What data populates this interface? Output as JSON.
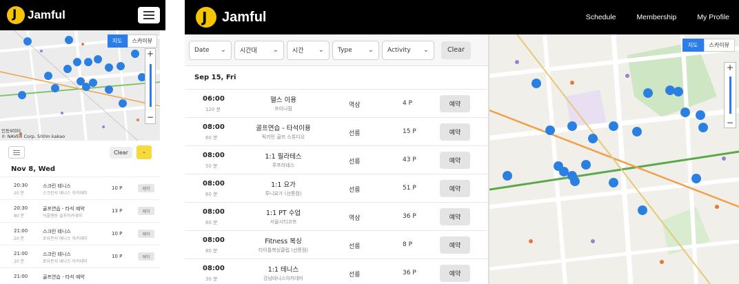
{
  "brand": {
    "name": "Jamful",
    "logo_letter": "J",
    "color": "#f6c400"
  },
  "mobile": {
    "map": {
      "type_buttons": [
        "지도",
        "스카이뷰"
      ],
      "footer_line1": "인동9미터",
      "footer_line2": "© NAVER Corp. 500m kakao"
    },
    "filters": {
      "clear": "Clear",
      "toggle_icon": "list-icon",
      "yellow": "-"
    },
    "date": "Nov 8, Wed",
    "sessions": [
      {
        "time": "20:30",
        "dur": "20 분",
        "title": "스크린 테니스",
        "sub": "스크린서 테니스 아카데미",
        "points": "10 P",
        "action": "예약"
      },
      {
        "time": "20:30",
        "dur": "80 분",
        "title": "골프연습 - 타석 예약",
        "sub": "어플렌동 골프아카데미",
        "points": "13 P",
        "action": "예약"
      },
      {
        "time": "21:00",
        "dur": "20 분",
        "title": "스크린 테니스",
        "sub": "로사몬서 테니스 아카데미",
        "points": "10 P",
        "action": "예약"
      },
      {
        "time": "21:00",
        "dur": "20 분",
        "title": "스크린 테니스",
        "sub": "로사몬서 테니스 아카데미",
        "points": "10 P",
        "action": "예약"
      },
      {
        "time": "21:00",
        "dur": "",
        "title": "골프연습 - 타석 예약",
        "sub": "",
        "points": "",
        "action": ""
      }
    ]
  },
  "desktop": {
    "nav": [
      "Schedule",
      "Membership",
      "My Profile"
    ],
    "filters": [
      "Date",
      "시간대",
      "시간",
      "Type",
      "Activity"
    ],
    "clear": "Clear",
    "date": "Sep 15, Fri",
    "sessions": [
      {
        "time": "06:00",
        "dur": "120 분",
        "title": "헬스 이용",
        "sub": "프이나짐",
        "loc": "역삼",
        "points": "4 P",
        "action": "예약"
      },
      {
        "time": "08:00",
        "dur": "60 분",
        "title": "골프연습 - 타석이용",
        "sub": "픽키민 골프 스튜디오",
        "loc": "선릉",
        "points": "15 P",
        "action": "예약"
      },
      {
        "time": "08:00",
        "dur": "50 분",
        "title": "1:1 필라테스",
        "sub": "루프라테스",
        "loc": "선릉",
        "points": "43 P",
        "action": "예약"
      },
      {
        "time": "08:00",
        "dur": "60 분",
        "title": "1:1 요가",
        "sub": "루니요가 (선릉점)",
        "loc": "선릉",
        "points": "51 P",
        "action": "예약"
      },
      {
        "time": "08:00",
        "dur": "60 분",
        "title": "1:1 PT 수업",
        "sub": "서울시티코프",
        "loc": "역삼",
        "points": "36 P",
        "action": "예약"
      },
      {
        "time": "08:00",
        "dur": "80 분",
        "title": "Fitness 복싱",
        "sub": "타이틀복싱클럽 (선릉점)",
        "loc": "선릉",
        "points": "8 P",
        "action": "예약"
      },
      {
        "time": "08:00",
        "dur": "30 분",
        "title": "1:1 테니스",
        "sub": "강남테니스아카데미",
        "loc": "선릉",
        "points": "36 P",
        "action": "예약"
      }
    ],
    "map": {
      "type_buttons": [
        "지도",
        "스카이뷰"
      ]
    }
  }
}
